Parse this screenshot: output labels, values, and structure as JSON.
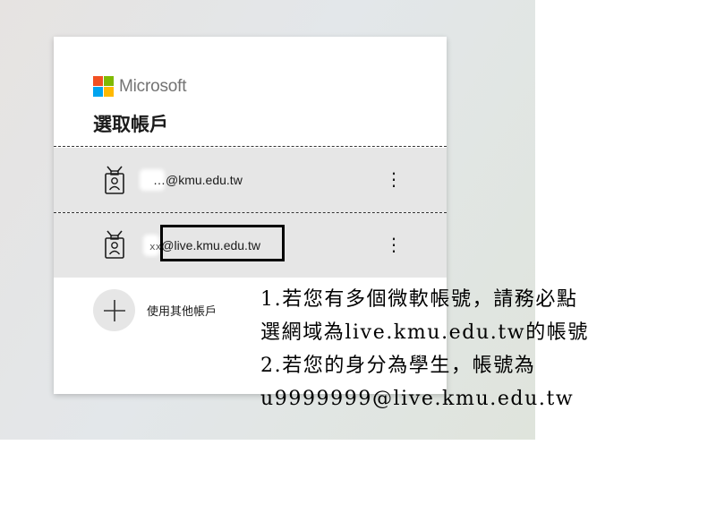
{
  "brand": {
    "name": "Microsoft",
    "logo_colors": [
      "#f25022",
      "#7fba00",
      "#00a4ef",
      "#ffb900"
    ]
  },
  "title": "選取帳戶",
  "accounts": [
    {
      "email_suffix": "@kmu.edu.tw",
      "icon": "badge-icon",
      "more_icon": "⋮"
    },
    {
      "email_prefix": "xx",
      "email_suffix": "@live.kmu.edu.tw",
      "icon": "badge-icon",
      "more_icon": "⋮"
    }
  ],
  "other_account": {
    "label": "使用其他帳戶",
    "icon": "plus-icon"
  },
  "annotation": {
    "lines": [
      "1.若您有多個微軟帳號，請務必點",
      "選網域為live.kmu.edu.tw的帳號",
      "2.若您的身分為學生，帳號為",
      "u9999999@live.kmu.edu.tw"
    ]
  },
  "colors": {
    "row_background": "#e6e6e6",
    "text": "#1b1b1b"
  }
}
